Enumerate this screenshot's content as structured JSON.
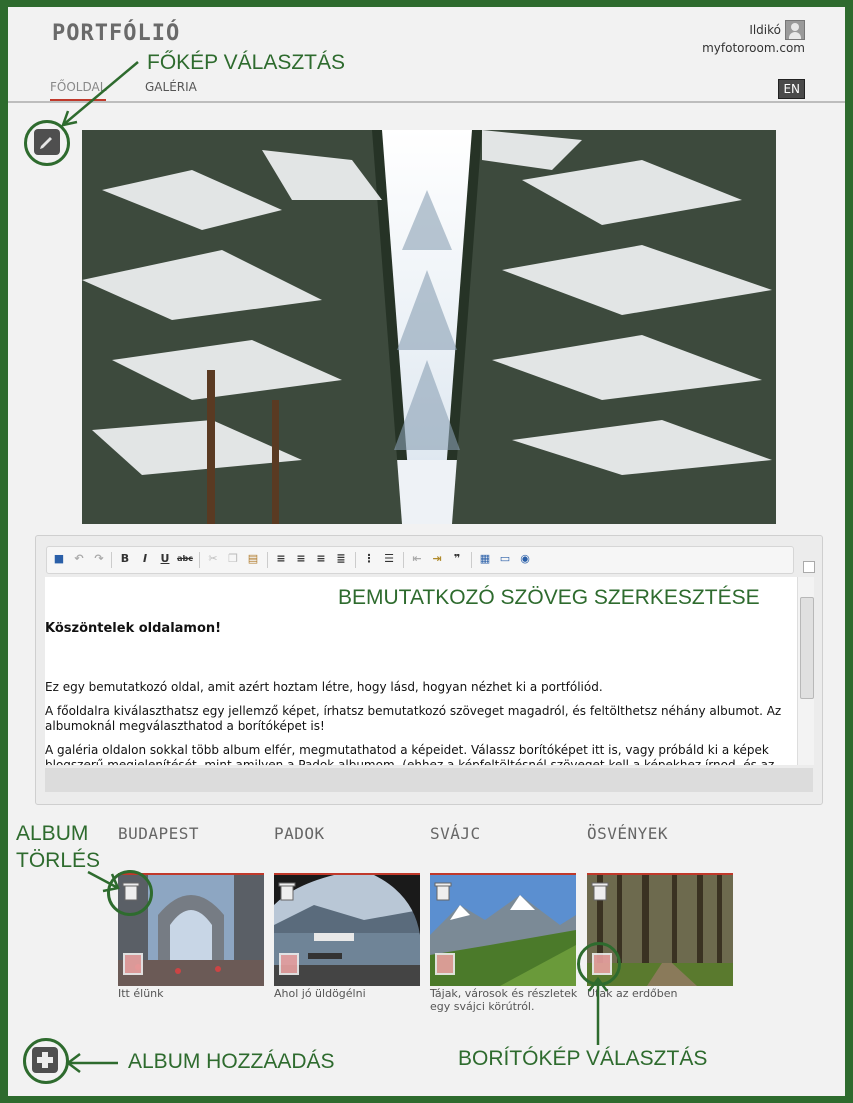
{
  "header": {
    "logo": "PORTFÓLIÓ",
    "user_name": "Ildikó",
    "site": "myfotoroom.com",
    "nav": [
      {
        "label": "FŐOLDAL",
        "active": true
      },
      {
        "label": "GALÉRIA",
        "active": false
      }
    ],
    "language": "EN"
  },
  "annotations": {
    "main_image": "FŐKÉP VÁLASZTÁS",
    "intro_text": "BEMUTATKOZÓ SZÖVEG SZERKESZTÉSE",
    "album_delete": "ALBUM",
    "album_delete2": "TÖRLÉS",
    "album_add": "ALBUM HOZZÁADÁS",
    "cover_select": "BORÍTÓKÉP VÁLASZTÁS",
    "color": "#2e6b2e"
  },
  "editor": {
    "heading": "Köszöntelek oldalamon!",
    "p1": "Ez egy bemutatkozó oldal, amit azért hoztam létre, hogy lásd, hogyan nézhet ki a portfóliód.",
    "p2": "A főoldalra kiválaszthatsz egy jellemző képet, írhatsz bemutatkozó szöveget magadról, és feltölthetsz néhány albumot. Az albumoknál megválaszthatod a borítóképet is!",
    "p3": "A galéria oldalon sokkal több album elfér, megmutathatod a képeidet. Válassz borítóképet itt is, vagy próbáld ki a képek blogszerű megjelenítését, mint amilyen a Padok albumom. (ehhez a képfeltöltésnél szöveget kell a képekhez írnod, és az"
  },
  "albums": [
    {
      "title": "BUDAPEST",
      "desc": "Itt élünk"
    },
    {
      "title": "PADOK",
      "desc": "Ahol jó üldögélni"
    },
    {
      "title": "SVÁJC",
      "desc": "Tájak, városok és részletek egy svájci körútról."
    },
    {
      "title": "ÖSVÉNYEK",
      "desc": "Utak az erdőben"
    }
  ]
}
